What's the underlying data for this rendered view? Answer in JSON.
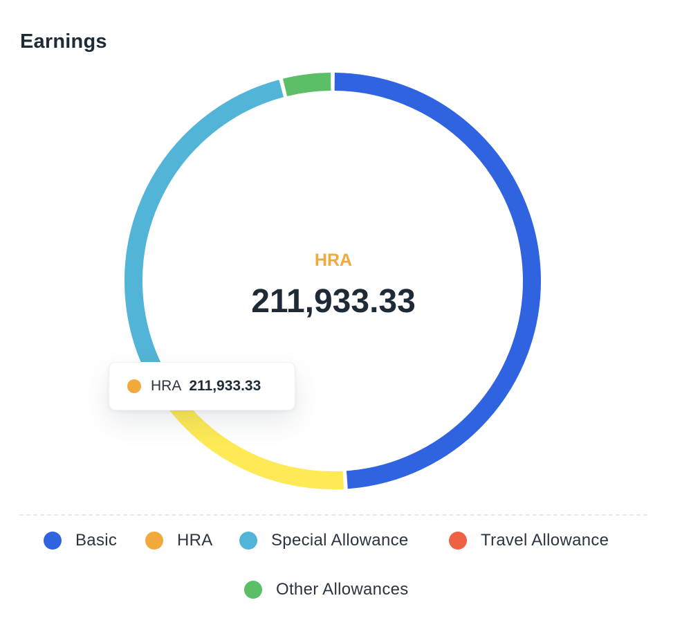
{
  "card": {
    "title": "Earnings"
  },
  "chart_data": {
    "type": "pie",
    "donut": true,
    "slices": [
      {
        "name": "Basic",
        "value": 0.49,
        "color": "#3063e0"
      },
      {
        "name": "HRA",
        "value": 211933.33,
        "value_label": "211,933.33",
        "color": "#f2a93b",
        "arc_color": "#fdea55"
      },
      {
        "name": "Special Allowance",
        "value": 0.29,
        "color": "#52b4d6"
      },
      {
        "name": "Travel Allowance",
        "value": 0,
        "color": "#ee6244"
      },
      {
        "name": "Other Allowances",
        "value": 0.04,
        "color": "#5cbf67"
      }
    ],
    "legend_position": "bottom"
  },
  "center": {
    "label": "HRA",
    "value": "211,933.33"
  },
  "tooltip": {
    "name": "HRA",
    "value": "211,933.33"
  },
  "legend": [
    {
      "label": "Basic",
      "color": "#3063e0"
    },
    {
      "label": "HRA",
      "color": "#f2a93b"
    },
    {
      "label": "Special Allowance",
      "color": "#52b4d6"
    },
    {
      "label": "Travel Allowance",
      "color": "#ee6244"
    },
    {
      "label": "Other Allowances",
      "color": "#5cbf67"
    }
  ]
}
